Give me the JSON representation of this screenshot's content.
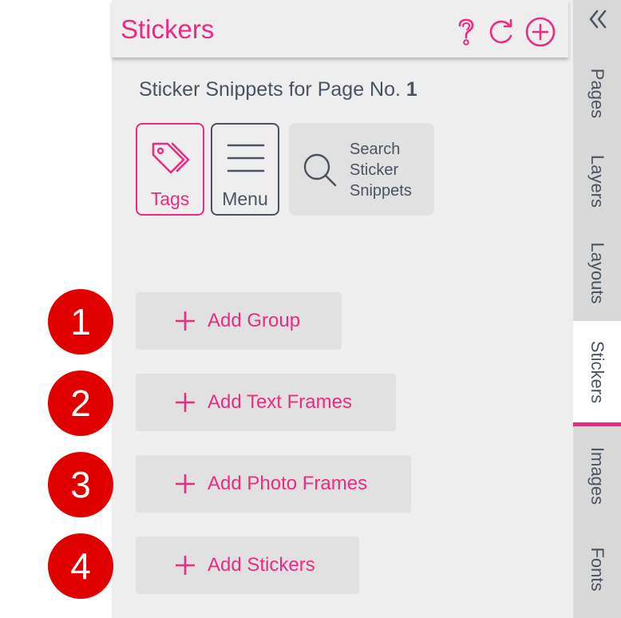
{
  "panel": {
    "title": "Stickers",
    "subtitle_prefix": "Sticker Snippets for Page No.",
    "page_number": "1"
  },
  "header_icons": [
    "question-icon",
    "refresh-icon",
    "add-circle-icon"
  ],
  "tools": {
    "tags_label": "Tags",
    "menu_label": "Menu",
    "search_line1": "Search",
    "search_line2": "Sticker",
    "search_line3": "Snippets"
  },
  "actions": [
    {
      "label": "Add Group",
      "badge": "1"
    },
    {
      "label": "Add Text Frames",
      "badge": "2"
    },
    {
      "label": "Add Photo Frames",
      "badge": "3"
    },
    {
      "label": "Add Stickers",
      "badge": "4"
    }
  ],
  "tabs": [
    "Pages",
    "Layers",
    "Layouts",
    "Stickers",
    "Images",
    "Fonts"
  ],
  "active_tab": "Stickers",
  "colors": {
    "accent": "#ee2a84",
    "panel_bg": "#eeeeee",
    "tab_bar_bg": "#d8d8d8",
    "text": "#4a5361",
    "badge": "#e00000"
  }
}
